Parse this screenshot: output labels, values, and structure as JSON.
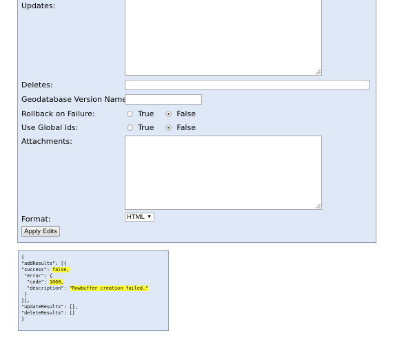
{
  "form": {
    "updates_label": "Updates:",
    "deletes_label": "Deletes:",
    "gdb_version_label": "Geodatabase Version Name:",
    "rollback_label": "Rollback on Failure:",
    "global_ids_label": "Use Global Ids:",
    "attachments_label": "Attachments:",
    "format_label": "Format:",
    "rollback_options": [
      "True",
      "False"
    ],
    "rollback_selected": "False",
    "global_ids_options": [
      "True",
      "False"
    ],
    "global_ids_selected": "False",
    "format_value": "HTML",
    "apply_button": "Apply Edits"
  },
  "result": {
    "lines": [
      "{",
      "\"addResults\": [{",
      " \"success\": false,",
      " \"error\": {",
      "  \"code\": 1060,",
      "  \"description\": \"Rowbuffer creation failed.\"",
      " }",
      "}],",
      "\"updateResults\": [],",
      "\"deleteResults\": []",
      "}"
    ]
  },
  "colors": {
    "panel_bg": "#dfe8f6",
    "panel_border": "#8a9bb2",
    "highlight": "#ffff33"
  }
}
